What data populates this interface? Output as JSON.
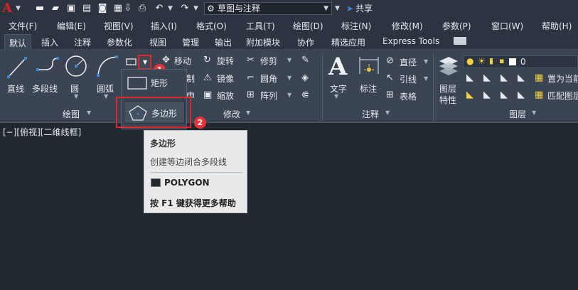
{
  "quick_access": {
    "workspace": "草图与注释",
    "share": "共享"
  },
  "menubar": [
    {
      "label": "文件(F)"
    },
    {
      "label": "编辑(E)"
    },
    {
      "label": "视图(V)"
    },
    {
      "label": "插入(I)"
    },
    {
      "label": "格式(O)"
    },
    {
      "label": "工具(T)"
    },
    {
      "label": "绘图(D)"
    },
    {
      "label": "标注(N)"
    },
    {
      "label": "修改(M)"
    },
    {
      "label": "参数(P)"
    },
    {
      "label": "窗口(W)"
    },
    {
      "label": "帮助(H)"
    }
  ],
  "tabs": [
    {
      "label": "默认"
    },
    {
      "label": "插入"
    },
    {
      "label": "注释"
    },
    {
      "label": "参数化"
    },
    {
      "label": "视图"
    },
    {
      "label": "管理"
    },
    {
      "label": "输出"
    },
    {
      "label": "附加模块"
    },
    {
      "label": "协作"
    },
    {
      "label": "精选应用"
    },
    {
      "label": "Express Tools"
    }
  ],
  "draw": {
    "title": "绘图",
    "line": "直线",
    "polyline": "多段线",
    "circle": "圆",
    "arc": "圆弧"
  },
  "modify": {
    "title": "修改",
    "move": "移动",
    "rotate": "旋转",
    "trim": "修剪",
    "mirror": "镜像",
    "fillet": "圆角",
    "scale": "缩放",
    "array": "阵列",
    "partial_copy": "制",
    "partial_stretch": "申"
  },
  "annotation": {
    "title": "注释",
    "text": "文字",
    "dimension": "标注",
    "diameter": "直径",
    "leader": "引线",
    "table": "表格"
  },
  "layers": {
    "title": "图层",
    "properties_line1": "图层",
    "properties_line2": "特性",
    "current_layer": "0",
    "set_current": "置为当前",
    "match_layer": "匹配图层"
  },
  "dropdown": {
    "rectangle": "矩形",
    "polygon": "多边形"
  },
  "badges": [
    "1",
    "2"
  ],
  "viewport_label": "[−][俯视][二维线框]",
  "tooltip": {
    "title": "多边形",
    "description": "创建等边闭合多段线",
    "command": "POLYGON",
    "help": "按 F1 键获得更多帮助"
  },
  "colors": {
    "accent_red": "#e0262b",
    "ribbon_bg": "#3a4452",
    "canvas_bg": "#212830",
    "tooltip_bg": "#e8e9ea"
  }
}
